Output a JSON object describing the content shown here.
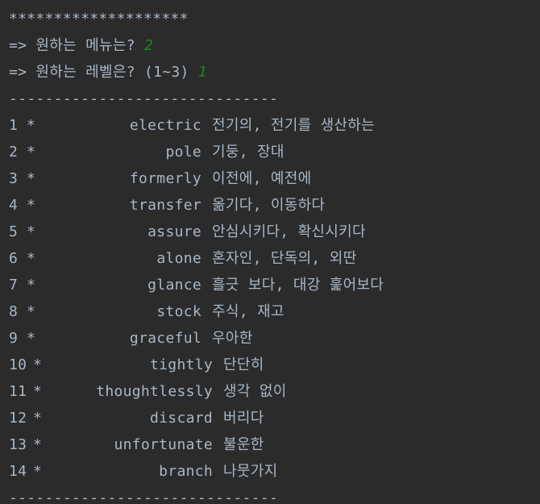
{
  "console": {
    "stars": "********************",
    "menu_prompt": "=> 원하는 메뉴는? ",
    "menu_value": "2",
    "level_prompt": "=> 원하는 레벨은? (1~3) ",
    "level_value": "1",
    "separator": "------------------------------",
    "rows": [
      {
        "num": "1",
        "star": "*",
        "word": "electric",
        "meaning": "전기의, 전기를 생산하는"
      },
      {
        "num": "2",
        "star": "*",
        "word": "pole",
        "meaning": "기둥, 장대"
      },
      {
        "num": "3",
        "star": "*",
        "word": "formerly",
        "meaning": "이전에, 예전에"
      },
      {
        "num": "4",
        "star": "*",
        "word": "transfer",
        "meaning": "옮기다, 이동하다"
      },
      {
        "num": "5",
        "star": "*",
        "word": "assure",
        "meaning": "안심시키다, 확신시키다"
      },
      {
        "num": "6",
        "star": "*",
        "word": "alone",
        "meaning": "혼자인, 단독의, 외딴"
      },
      {
        "num": "7",
        "star": "*",
        "word": "glance",
        "meaning": "흘긋 보다, 대강 훑어보다"
      },
      {
        "num": "8",
        "star": "*",
        "word": "stock",
        "meaning": "주식, 재고"
      },
      {
        "num": "9",
        "star": "*",
        "word": "graceful",
        "meaning": "우아한"
      },
      {
        "num": "10",
        "star": "*",
        "word": "tightly",
        "meaning": "단단히"
      },
      {
        "num": "11",
        "star": "*",
        "word": "thoughtlessly",
        "meaning": "생각 없이"
      },
      {
        "num": "12",
        "star": "*",
        "word": "discard",
        "meaning": "버리다"
      },
      {
        "num": "13",
        "star": "*",
        "word": "unfortunate",
        "meaning": "불운한"
      },
      {
        "num": "14",
        "star": "*",
        "word": "branch",
        "meaning": "나뭇가지"
      }
    ],
    "colors": {
      "background": "#2b2b2b",
      "text": "#a9b7c6",
      "user_input": "#1c8a1c"
    }
  }
}
